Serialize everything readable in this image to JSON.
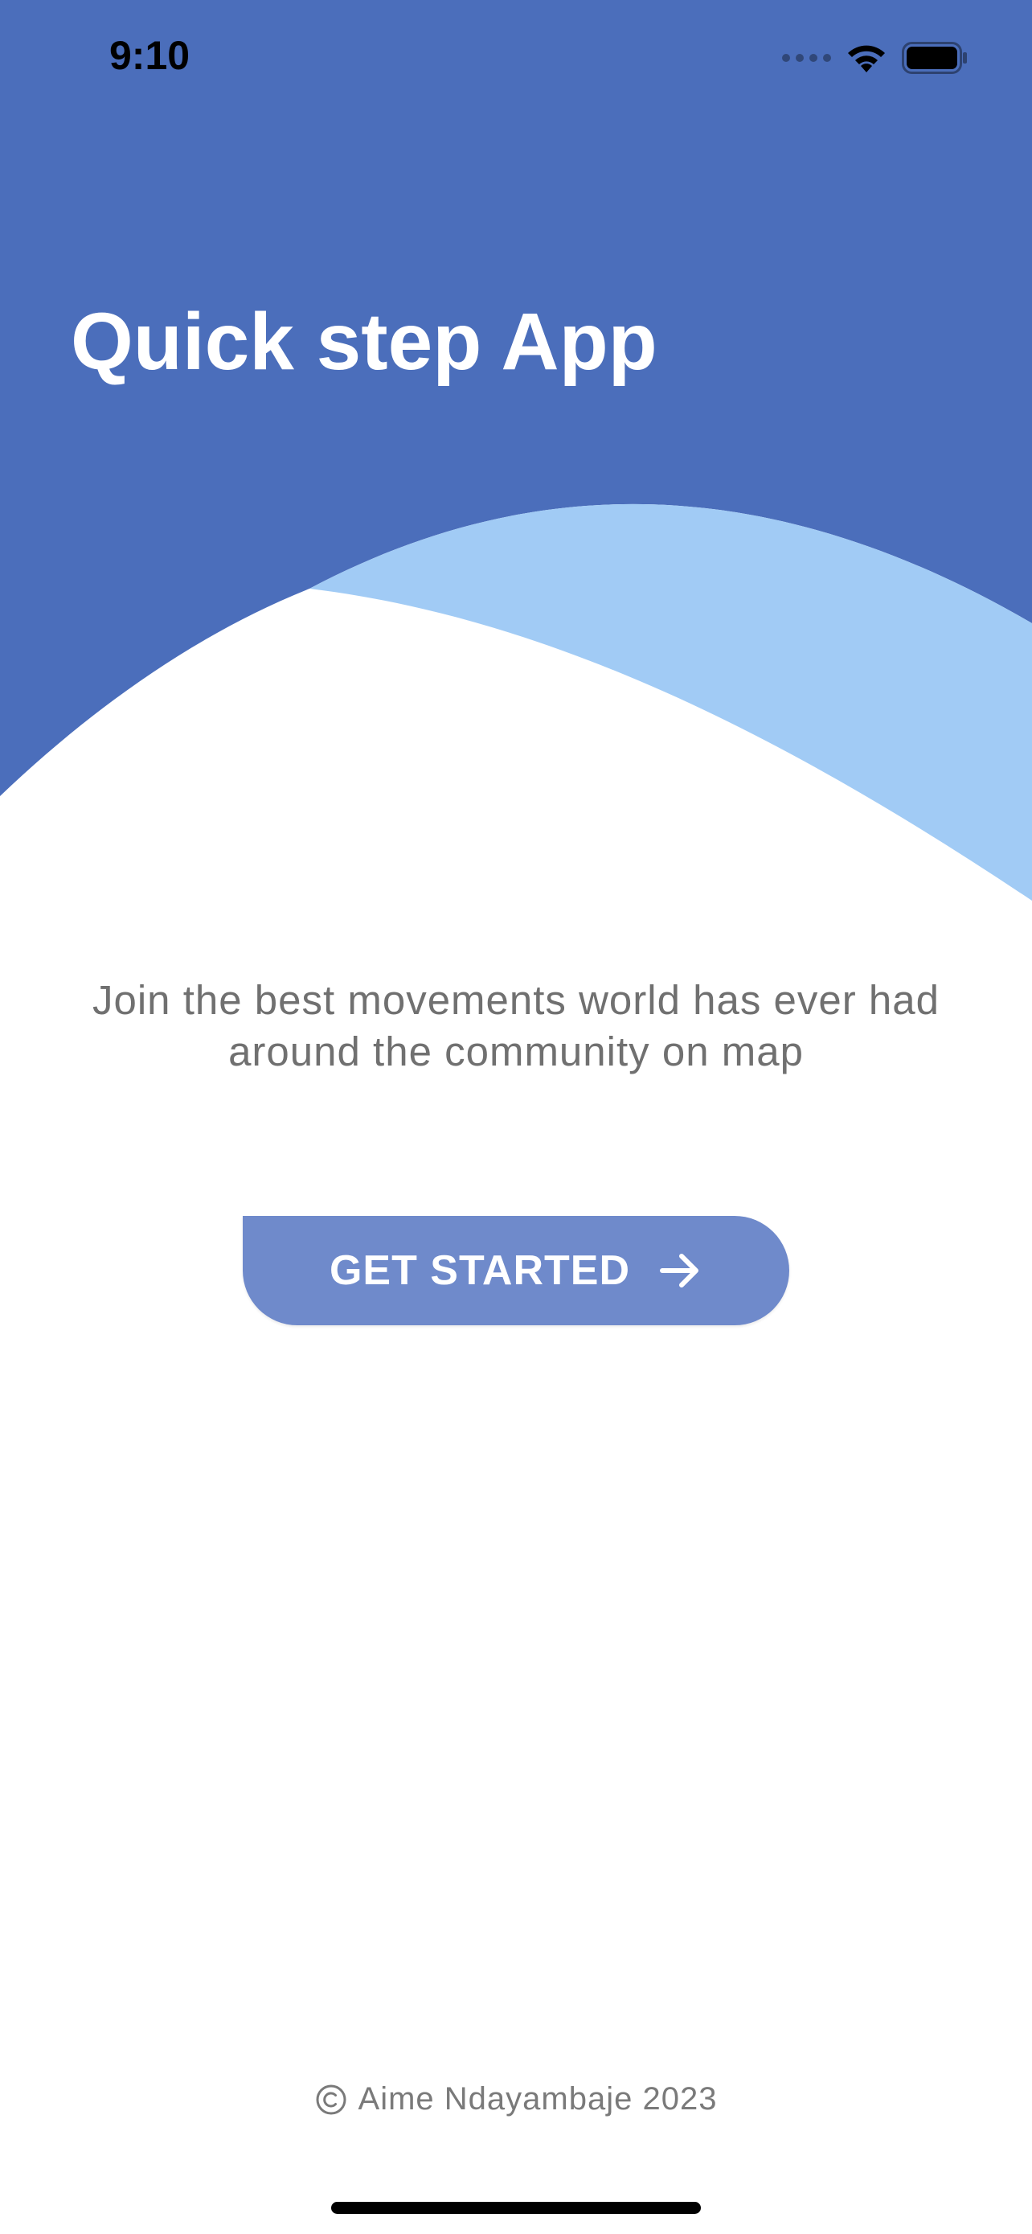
{
  "status_bar": {
    "time": "9:10",
    "icons": [
      "signal-dots-icon",
      "wifi-icon",
      "battery-icon"
    ]
  },
  "header": {
    "title": "Quick step App"
  },
  "main": {
    "tagline": "Join the best movements world has ever had around the community on map",
    "cta_label": "GET STARTED",
    "cta_icon": "arrow-right-icon"
  },
  "footer": {
    "icon": "copyright-icon",
    "text": "Aime Ndayambaje 2023"
  },
  "colors": {
    "primary_blue": "#4b6ebb",
    "light_blue": "#a1cbf5",
    "button_blue": "#6f8acb",
    "text_gray": "#707070",
    "background": "#ffffff"
  }
}
